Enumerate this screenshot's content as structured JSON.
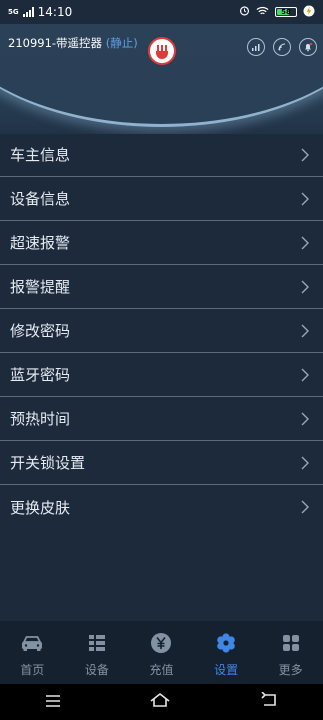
{
  "status": {
    "network": "5G",
    "time": "14:10",
    "battery": "58"
  },
  "header": {
    "device_id": "210991-带遥控器",
    "device_state": "(静止)"
  },
  "menu": [
    {
      "label": "车主信息"
    },
    {
      "label": "设备信息"
    },
    {
      "label": "超速报警"
    },
    {
      "label": "报警提醒"
    },
    {
      "label": "修改密码"
    },
    {
      "label": "蓝牙密码"
    },
    {
      "label": "预热时间"
    },
    {
      "label": "开关锁设置"
    },
    {
      "label": "更换皮肤"
    }
  ],
  "tabs": [
    {
      "label": "首页",
      "icon": "car-icon"
    },
    {
      "label": "设备",
      "icon": "list-icon"
    },
    {
      "label": "充值",
      "icon": "yen-icon"
    },
    {
      "label": "设置",
      "icon": "gear-icon",
      "active": true
    },
    {
      "label": "更多",
      "icon": "grid-icon"
    }
  ],
  "colors": {
    "accent": "#3f87e6",
    "background": "#1d2a3c",
    "logo_red": "#e23a3a"
  }
}
